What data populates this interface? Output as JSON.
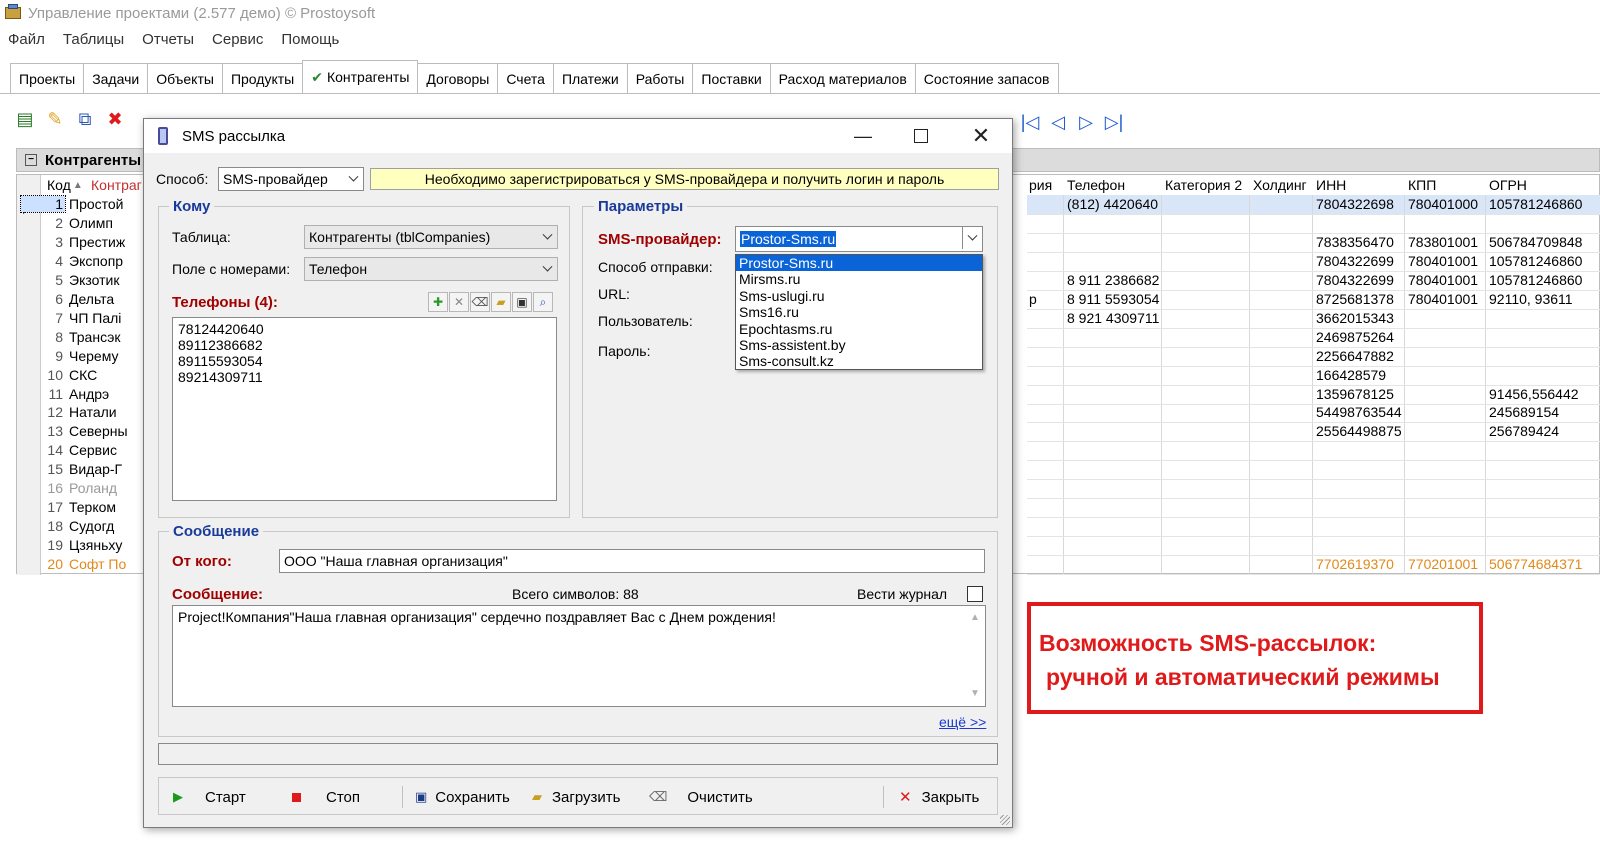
{
  "app": {
    "title": "Управление проектами (2.577 демо) © Prostoysoft",
    "menu": [
      "Файл",
      "Таблицы",
      "Отчеты",
      "Сервис",
      "Помощь"
    ],
    "tabs": [
      "Проекты",
      "Задачи",
      "Объекты",
      "Продукты",
      "Контрагенты",
      "Договоры",
      "Счета",
      "Платежи",
      "Работы",
      "Поставки",
      "Расход материалов",
      "Состояние запасов"
    ],
    "active_tab": "Контрагенты"
  },
  "grid": {
    "panel_title": "Контрагенты",
    "head_code": "Код",
    "head_name": "Контраг",
    "head_right": [
      "рия",
      "Телефон",
      "Категория 2",
      "Холдинг",
      "ИНН",
      "КПП",
      "ОГРН"
    ],
    "rows": [
      {
        "n": "1",
        "name": "Простой",
        "r": [
          "(812) 4420640",
          "7804322698",
          "780401000",
          "105781246860"
        ]
      },
      {
        "n": "2",
        "name": "Олимп",
        "r": [
          "",
          "",
          "",
          ""
        ]
      },
      {
        "n": "3",
        "name": "Престиж",
        "r": [
          "",
          "7838356470",
          "783801001",
          "506784709848"
        ]
      },
      {
        "n": "4",
        "name": "Экспопр",
        "r": [
          "",
          "7804322699",
          "780401001",
          "105781246860"
        ]
      },
      {
        "n": "5",
        "name": "Экзотик",
        "r": [
          "8 911 2386682",
          "7804322699",
          "780401001",
          "105781246860"
        ]
      },
      {
        "n": "6",
        "name": "Дельта",
        "pre": "р",
        "r": [
          "8 911 5593054",
          "8725681378",
          "780401001",
          "92110, 93611"
        ]
      },
      {
        "n": "7",
        "name": "ЧП Палі",
        "r": [
          "8 921 4309711",
          "3662015343",
          "",
          ""
        ]
      },
      {
        "n": "8",
        "name": "Трансэк",
        "r": [
          "",
          "2469875264",
          "",
          ""
        ]
      },
      {
        "n": "9",
        "name": "Черему",
        "r": [
          "",
          "2256647882",
          "",
          ""
        ]
      },
      {
        "n": "10",
        "name": "СКС",
        "r": [
          "",
          "166428579",
          "",
          ""
        ]
      },
      {
        "n": "11",
        "name": "Андрэ",
        "r": [
          "",
          "1359678125",
          "",
          "91456,556442"
        ]
      },
      {
        "n": "12",
        "name": "Натали",
        "r": [
          "",
          "54498763544",
          "",
          "245689154"
        ]
      },
      {
        "n": "13",
        "name": "Северны",
        "r": [
          "",
          "25564498875",
          "",
          "256789424"
        ]
      },
      {
        "n": "14",
        "name": "Сервис",
        "r": [
          "",
          "",
          "",
          ""
        ]
      },
      {
        "n": "15",
        "name": "Видар-Г",
        "r": [
          "",
          "",
          "",
          ""
        ]
      },
      {
        "n": "16",
        "name": "Роланд",
        "r": [
          "",
          "",
          "",
          ""
        ]
      },
      {
        "n": "17",
        "name": "Терком",
        "r": [
          "",
          "",
          "",
          ""
        ]
      },
      {
        "n": "18",
        "name": "Судогд",
        "r": [
          "",
          "",
          "",
          ""
        ]
      },
      {
        "n": "19",
        "name": "Цзяньху",
        "r": [
          "",
          "",
          "",
          ""
        ]
      },
      {
        "n": "20",
        "name": "Софт По",
        "r": [
          "",
          "7702619370",
          "770201001",
          "506774684371"
        ]
      }
    ]
  },
  "dialog": {
    "title": "SMS рассылка",
    "method_label": "Способ:",
    "method_value": "SMS-провайдер",
    "info": "Необходимо зарегистрироваться у SMS-провайдера и получить логин и пароль",
    "to_group": "Кому",
    "table_label": "Таблица:",
    "table_value": "Контрагенты (tblCompanies)",
    "field_label": "Поле с номерами:",
    "field_value": "Телефон",
    "phones_label": "Телефоны (4):",
    "phones": [
      "78124420640",
      "89112386682",
      "89115593054",
      "89214309711"
    ],
    "params_group": "Параметры",
    "provider_label": "SMS-провайдер:",
    "provider_value": "Prostor-Sms.ru",
    "send_method_label": "Способ отправки:",
    "url_label": "URL:",
    "user_label": "Пользователь:",
    "password_label": "Пароль:",
    "provider_options": [
      "Prostor-Sms.ru",
      "Mirsms.ru",
      "Sms-uslugi.ru",
      "Sms16.ru",
      "Epochtasms.ru",
      "Sms-assistent.by",
      "Sms-consult.kz"
    ],
    "message_group": "Сообщение",
    "from_label": "От кого:",
    "from_value": "ООО \"Наша главная организация\"",
    "message_label": "Сообщение:",
    "total_chars": "Всего символов: 88",
    "log_label": "Вести журнал",
    "message_text": "Project!Компания\"Наша главная организация\" сердечно поздравляет Вас с Днем рождения!",
    "more_link": "ещё >>",
    "buttons": {
      "start": "Старт",
      "stop": "Стоп",
      "save": "Сохранить",
      "load": "Загрузить",
      "clear": "Очистить",
      "close": "Закрыть"
    }
  },
  "callout": {
    "line1": "Возможность SMS-рассылок:",
    "line2": "ручной и автоматический режимы"
  },
  "colors": {
    "accent_red": "#e01a1a",
    "label_red": "#a00000",
    "label_blue": "#1a3a9a",
    "banner_yellow": "#ffffc0",
    "selection_blue": "#0a64d8"
  }
}
